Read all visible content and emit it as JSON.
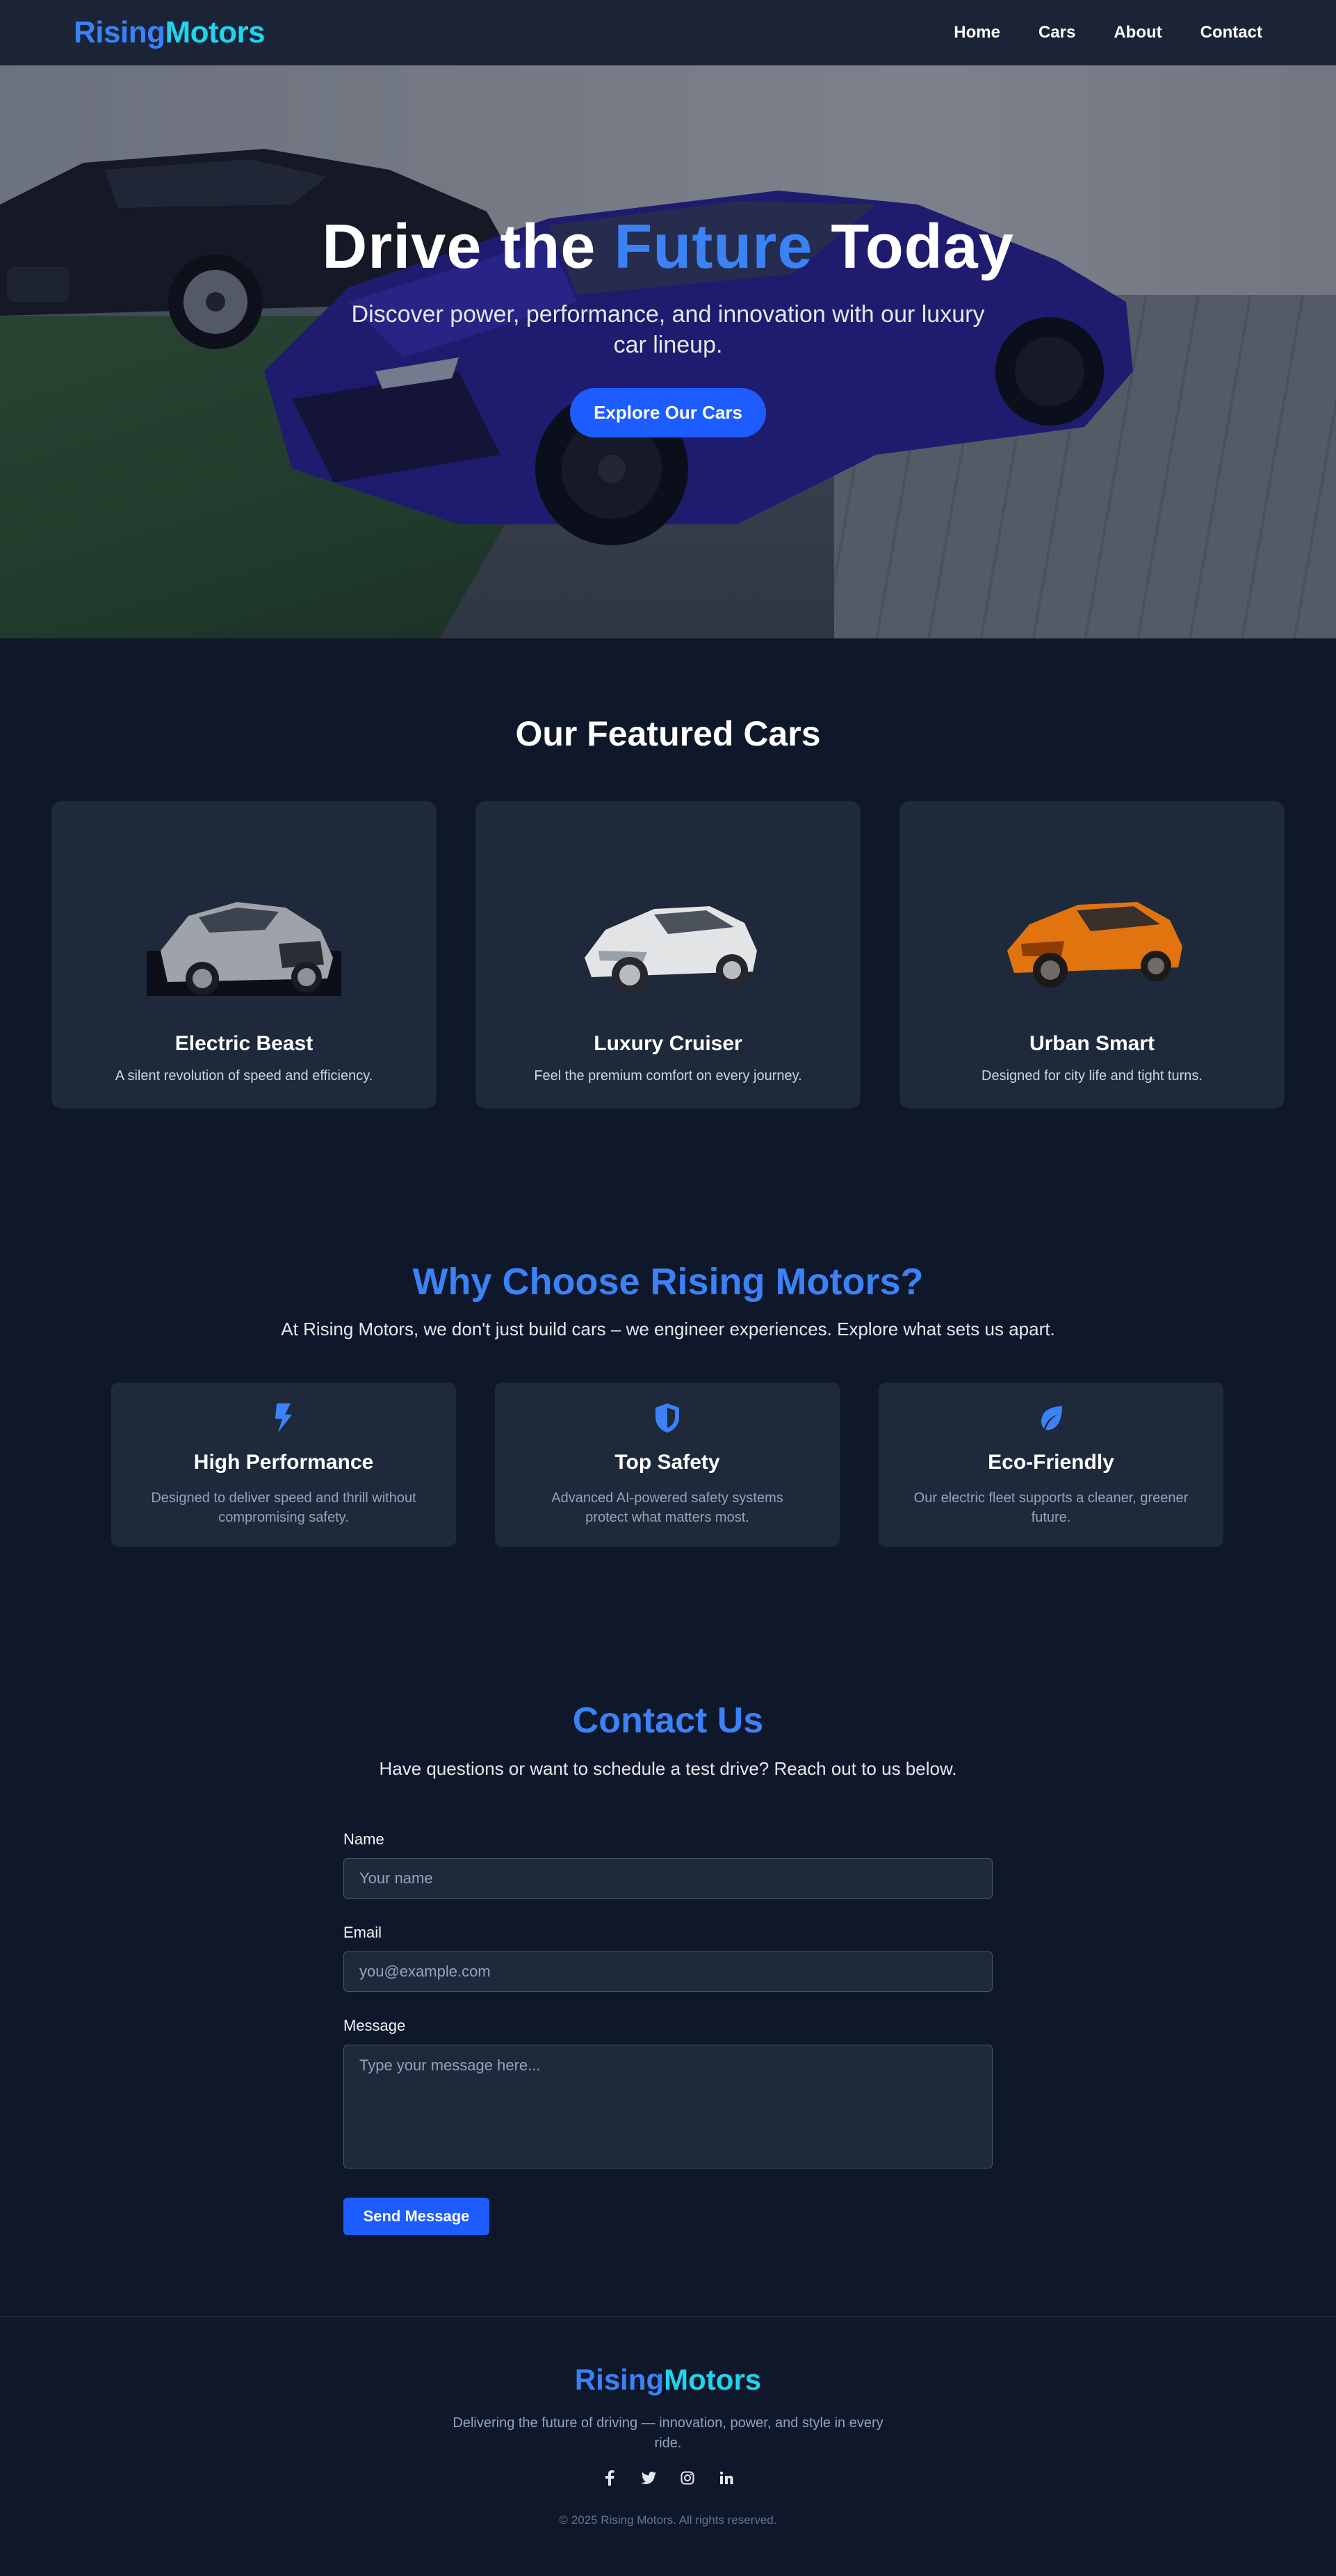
{
  "nav": {
    "logo_part1": "Rising",
    "logo_part2": "Motors",
    "links": [
      "Home",
      "Cars",
      "About",
      "Contact"
    ]
  },
  "hero": {
    "title_pre": "Drive the ",
    "title_accent": "Future",
    "title_post": " Today",
    "subtitle": "Discover power, performance, and innovation with our luxury car lineup.",
    "cta": "Explore Our Cars"
  },
  "featured": {
    "title": "Our Featured Cars",
    "cards": [
      {
        "title": "Electric Beast",
        "desc": "A silent revolution of speed and efficiency.",
        "icon": "silver-car-image"
      },
      {
        "title": "Luxury Cruiser",
        "desc": "Feel the premium comfort on every journey.",
        "icon": "white-car-image"
      },
      {
        "title": "Urban Smart",
        "desc": "Designed for city life and tight turns.",
        "icon": "orange-car-image"
      }
    ]
  },
  "why": {
    "title": "Why Choose Rising Motors?",
    "subtitle": "At Rising Motors, we don't just build cars – we engineer experiences. Explore what sets us apart.",
    "features": [
      {
        "title": "High Performance",
        "desc": "Designed to deliver speed and thrill without compromising safety.",
        "icon": "bolt-icon"
      },
      {
        "title": "Top Safety",
        "desc": "Advanced AI-powered safety systems protect what matters most.",
        "icon": "shield-icon"
      },
      {
        "title": "Eco-Friendly",
        "desc": "Our electric fleet supports a cleaner, greener future.",
        "icon": "leaf-icon"
      }
    ]
  },
  "contact": {
    "title": "Contact Us",
    "subtitle": "Have questions or want to schedule a test drive? Reach out to us below.",
    "name_label": "Name",
    "name_placeholder": "Your name",
    "email_label": "Email",
    "email_placeholder": "you@example.com",
    "message_label": "Message",
    "message_placeholder": "Type your message here...",
    "submit": "Send Message"
  },
  "footer": {
    "logo_part1": "Rising",
    "logo_part2": "Motors",
    "desc": "Delivering the future of driving — innovation, power, and style in every ride.",
    "socials": [
      "facebook-icon",
      "twitter-icon",
      "instagram-icon",
      "linkedin-icon"
    ],
    "copyright": "© 2025 Rising Motors. All rights reserved."
  },
  "colors": {
    "background": "#0f172a",
    "card": "#1e293b",
    "accent": "#3b82f6",
    "accent_cyan": "#22d3ee",
    "button": "#1d5cff"
  }
}
